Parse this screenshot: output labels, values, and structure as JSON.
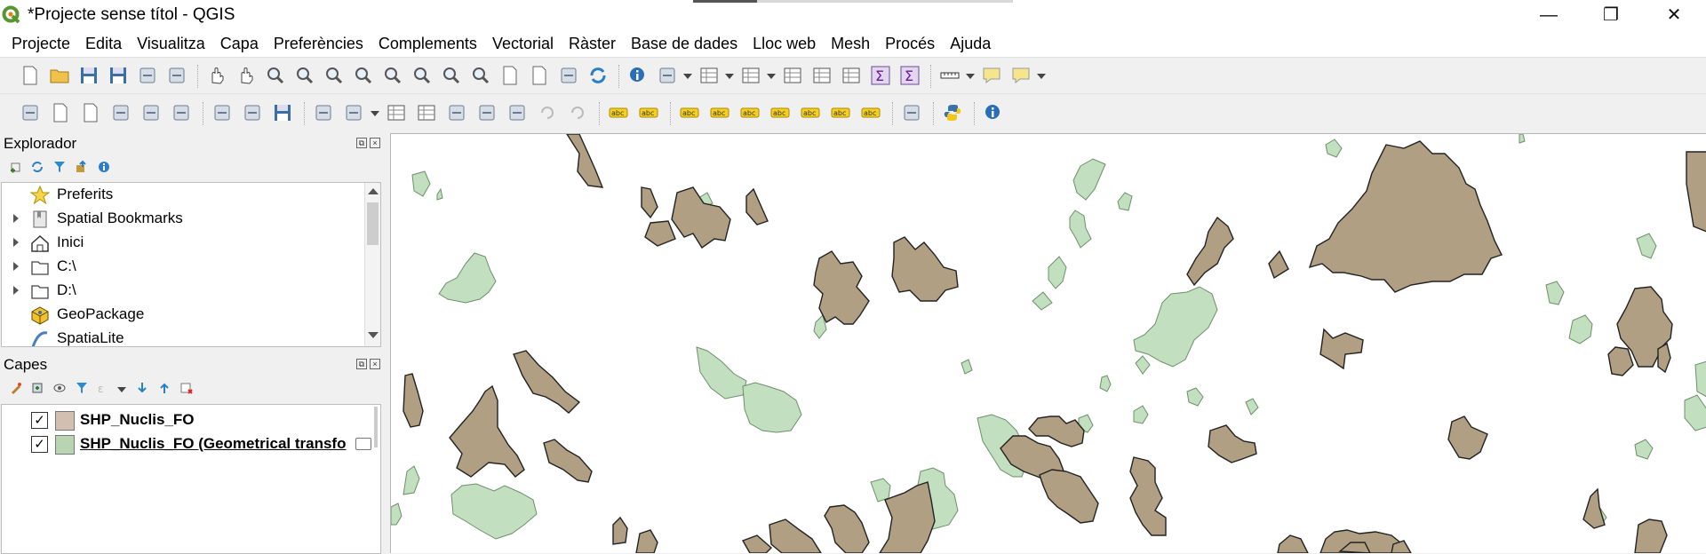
{
  "window": {
    "title": "*Projecte sense títol - QGIS",
    "controls": {
      "minimize": "—",
      "maximize": "❐",
      "close": "✕"
    }
  },
  "menu": [
    "Projecte",
    "Edita",
    "Visualitza",
    "Capa",
    "Preferències",
    "Complements",
    "Vectorial",
    "Ràster",
    "Base de dades",
    "Lloc web",
    "Mesh",
    "Procés",
    "Ajuda"
  ],
  "toolbar_icons": {
    "row1": [
      "new-project-icon",
      "open-project-icon",
      "save-project-icon",
      "save-as-icon",
      "print-layout-icon",
      "style-manager-icon",
      "pan-icon",
      "pan-to-selection-icon",
      "zoom-in-icon",
      "zoom-out-icon",
      "zoom-full-icon",
      "zoom-to-selection-icon",
      "zoom-to-layer-icon",
      "zoom-native-icon",
      "zoom-last-icon",
      "zoom-next-icon",
      "new-map-view-icon",
      "new-bookmark-icon",
      "show-bookmarks-icon",
      "refresh-icon",
      "identify-icon",
      "action-icon",
      "select-features-icon",
      "select-by-value-icon",
      "deselect-icon",
      "attribute-table-icon",
      "field-calculator-icon",
      "processing-toolbox-icon",
      "statistics-icon",
      "measure-icon",
      "map-tips-icon",
      "text-annotation-icon"
    ],
    "row2": [
      "data-source-manager-icon",
      "new-geopackage-icon",
      "new-shapefile-icon",
      "digitize-icon",
      "temporary-layer-icon",
      "virtual-layer-icon",
      "current-edits-icon",
      "toggle-editing-icon",
      "save-edits-icon",
      "add-feature-icon",
      "vertex-tool-icon",
      "modify-attributes-icon",
      "delete-selected-icon",
      "cut-features-icon",
      "copy-features-icon",
      "paste-features-icon",
      "undo-icon",
      "redo-icon",
      "label-icon",
      "diagram-icon",
      "label-toolbar-icon",
      "rule-label-icon",
      "pin-labels-icon",
      "show-labels-icon",
      "move-label-icon",
      "rotate-label-icon",
      "change-label-icon",
      "plugin-globe-icon",
      "python-console-icon",
      "help-icon"
    ]
  },
  "browser": {
    "title": "Explorador",
    "items": [
      {
        "label": "Preferits",
        "icon": "star-icon",
        "expandable": false
      },
      {
        "label": "Spatial Bookmarks",
        "icon": "bookmark-icon",
        "expandable": true
      },
      {
        "label": "Inici",
        "icon": "home-icon",
        "expandable": true
      },
      {
        "label": "C:\\",
        "icon": "folder-icon",
        "expandable": true
      },
      {
        "label": "D:\\",
        "icon": "folder-icon",
        "expandable": true
      },
      {
        "label": "GeoPackage",
        "icon": "geopackage-icon",
        "expandable": false
      },
      {
        "label": "SpatiaLite",
        "icon": "spatialite-icon",
        "expandable": false
      }
    ]
  },
  "layers": {
    "title": "Capes",
    "items": [
      {
        "name": "SHP_Nuclis_FO",
        "checked": true,
        "color": "#d3bfb2"
      },
      {
        "name": "SHP_Nuclis_FO (Geometrical transfo",
        "checked": true,
        "color": "#b8d4b0"
      }
    ]
  },
  "map": {
    "polygon_fill_brown": "#b09f82",
    "polygon_fill_green": "#c2dfbf",
    "stroke": "#222222",
    "stroke_green": "#6d8f6a"
  }
}
